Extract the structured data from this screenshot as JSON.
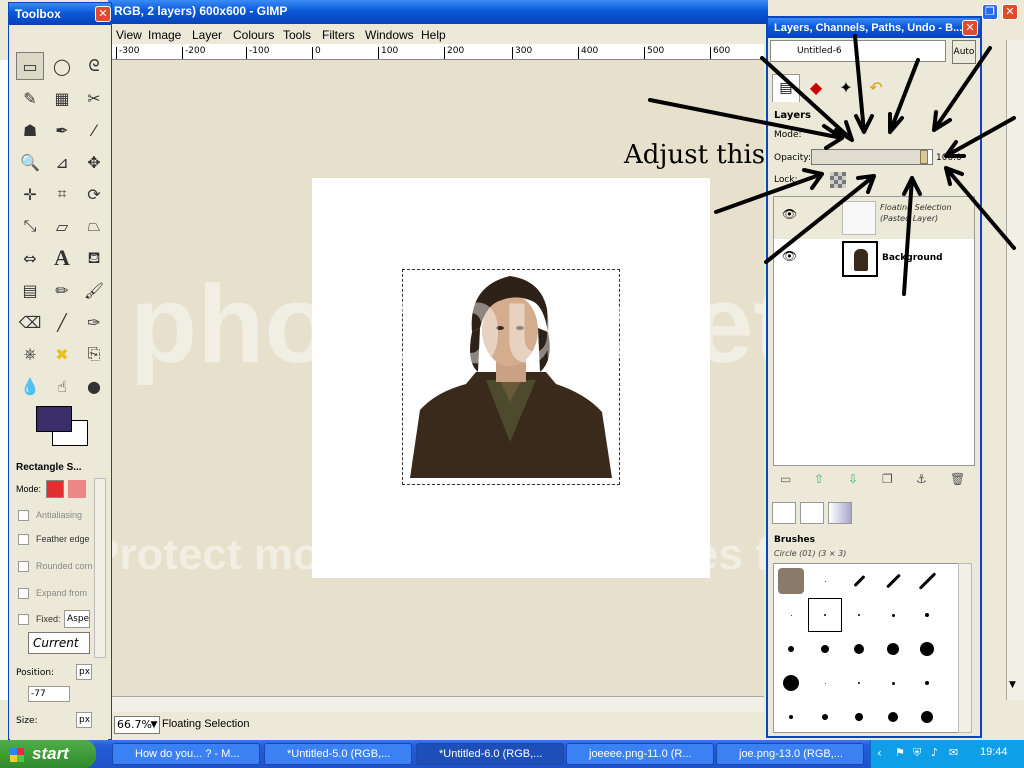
{
  "main_window": {
    "title": "RGB, 2 layers) 600x600 - GIMP",
    "menu": [
      "View",
      "Image",
      "Layer",
      "Colours",
      "Tools",
      "Filters",
      "Windows",
      "Help"
    ],
    "ruler_ticks": [
      "-300",
      "-200",
      "-100",
      "0",
      "100",
      "200",
      "300",
      "400",
      "500",
      "600"
    ],
    "zoom": "66.7%",
    "status": "Floating Selection"
  },
  "toolbox": {
    "title": "Toolbox",
    "options_title": "Rectangle S...",
    "mode_label": "Mode:",
    "antialiasing": "Antialiasing",
    "feather": "Feather edge",
    "rounded": "Rounded corn",
    "expand": "Expand from",
    "fixed_label": "Fixed:",
    "fixed_value": "Aspec",
    "current": "Current",
    "position_label": "Position:",
    "position_unit": "px",
    "position_value": "-77",
    "size_label": "Size:",
    "size_unit": "px"
  },
  "layers_dock": {
    "title": "Layers, Channels, Paths, Undo - B...",
    "image_selector": "Untitled-6",
    "auto_button": "Auto",
    "panel_title": "Layers",
    "mode_label": "Mode:",
    "opacity_label": "Opacity:",
    "opacity_value": "100.0",
    "opacity_fraction": 0.93,
    "lock_label": "Lock:",
    "layers": [
      {
        "name_line1": "Floating Selection",
        "name_line2": "(Pasted Layer)"
      },
      {
        "name_line1": "Background",
        "name_line2": ""
      }
    ],
    "brushes_title": "Brushes",
    "brush_name": "Circle (01) (3 × 3)"
  },
  "annotation": "Adjust this",
  "watermark_line1": "photobucket",
  "watermark_line2": "Protect more of your memories for less!",
  "taskbar": {
    "start": "start",
    "tasks": [
      "How do you... ? - M...",
      "*Untitled-5.0 (RGB,...",
      "*Untitled-6.0 (RGB,...",
      "joeeee.png-11.0 (R...",
      "joe.png-13.0 (RGB,..."
    ],
    "clock": "19:44"
  },
  "colors": {
    "foreground": "#3b2d6a",
    "background": "#ffffff",
    "titlebar": "#0a58d8"
  }
}
